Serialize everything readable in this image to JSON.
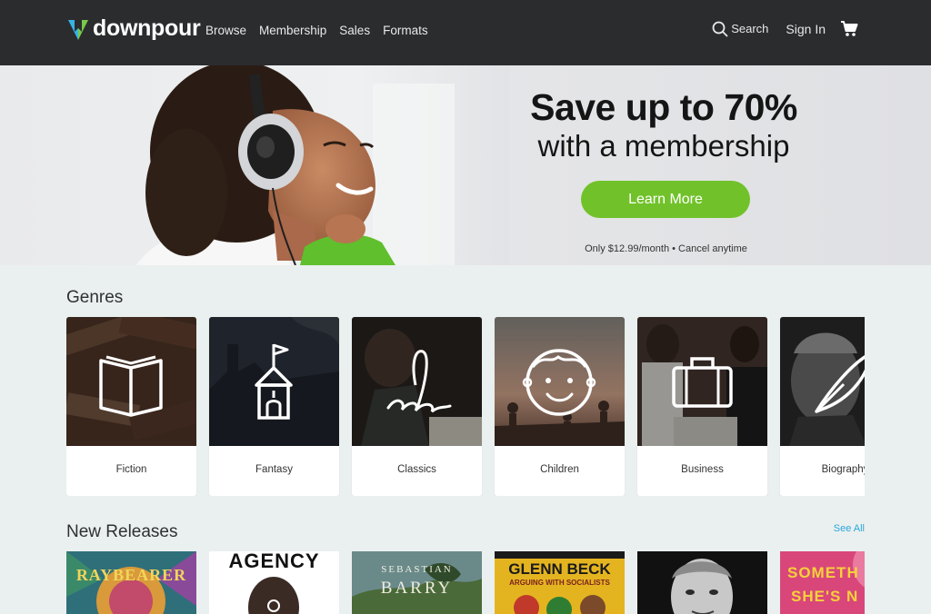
{
  "brand": {
    "name": "downpour"
  },
  "nav": {
    "links": [
      "Browse",
      "Membership",
      "Sales",
      "Formats"
    ],
    "search_label": "Search",
    "signin_label": "Sign In"
  },
  "hero": {
    "title": "Save up to 70%",
    "subtitle": "with a membership",
    "button_label": "Learn More",
    "note": "Only $12.99/month  •  Cancel anytime"
  },
  "genres": {
    "title": "Genres",
    "items": [
      {
        "label": "Fiction",
        "icon": "open-book-icon"
      },
      {
        "label": "Fantasy",
        "icon": "castle-tower-icon"
      },
      {
        "label": "Classics",
        "icon": "quill-signature-icon"
      },
      {
        "label": "Children",
        "icon": "child-face-icon"
      },
      {
        "label": "Business",
        "icon": "briefcase-icon"
      },
      {
        "label": "Biography",
        "icon": "feather-pen-icon"
      }
    ]
  },
  "new_releases": {
    "title": "New Releases",
    "see_all": "See All",
    "books": [
      {
        "title": "RAYBEARER"
      },
      {
        "title": "AGENCY"
      },
      {
        "author": "SEBASTIAN",
        "author2": "BARRY"
      },
      {
        "title": "GLENN BECK",
        "subtitle": "ARGUING WITH SOCIALISTS"
      },
      {
        "title": ""
      },
      {
        "title": "SOMETH",
        "title2": "SHE'S N"
      }
    ]
  },
  "colors": {
    "nav_bg": "#2b2c2e",
    "accent_green": "#71c22a",
    "link_blue": "#2aa6d9",
    "page_bg": "#eaf0ef"
  }
}
